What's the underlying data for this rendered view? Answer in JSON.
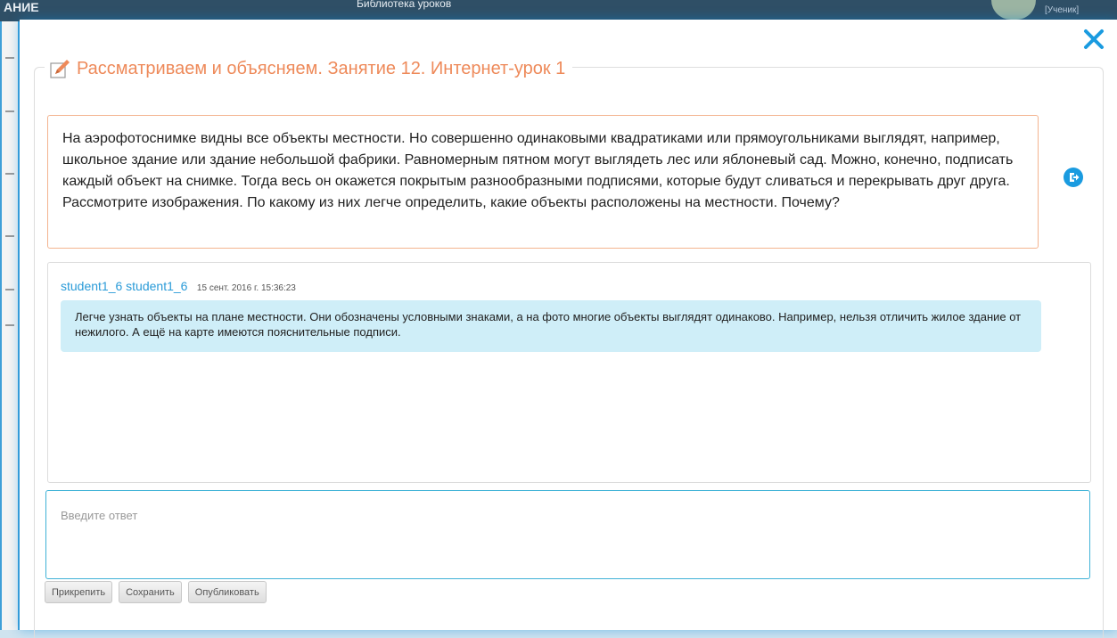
{
  "background_app": {
    "header_fragments": [
      "АНИЕ",
      "Библиотека уроков"
    ],
    "role": "[Ученик]"
  },
  "modal": {
    "title": "Рассматриваем и объясняем. Занятие 12. Интернет-урок 1",
    "task": {
      "paragraph1": "На аэрофотоснимке видны все объекты местности. Но совершенно одинаковыми квадратиками или прямоугольниками выглядят, например, школьное здание или здание небольшой фабрики. Равномерным пятном могут выглядеть лес или яблоневый сад. Можно, конечно, подписать каждый объект на снимке. Тогда весь он окажется покрытым разнообразными подписями, которые будут сливаться и перекрывать друг друга.",
      "paragraph2": "Рассмотрите изображения. По какому из них легче определить, какие объекты расположены на местности. Почему?"
    },
    "answer": {
      "user": "student1_6 student1_6",
      "date": "15 сент. 2016 г. 15:36:23",
      "text": "Легче узнать объекты на плане местности. Они обозначены условными знаками, а на фото многие объекты выглядят одинаково. Например, нельзя отличить жилое здание от нежилого. А ещё на карте имеются пояснительные подписи."
    },
    "reply": {
      "placeholder": "Введите ответ",
      "value": ""
    },
    "buttons": {
      "attach": "Прикрепить",
      "save": "Сохранить",
      "publish": "Опубликовать"
    }
  },
  "icons": {
    "close": "close-icon",
    "title": "pencil-note-icon",
    "export": "export-arrow-icon"
  },
  "colors": {
    "accent_orange": "#ee8a5a",
    "accent_blue": "#1a9be0",
    "answer_bubble": "#cfeef8",
    "task_border": "#f4b490"
  }
}
